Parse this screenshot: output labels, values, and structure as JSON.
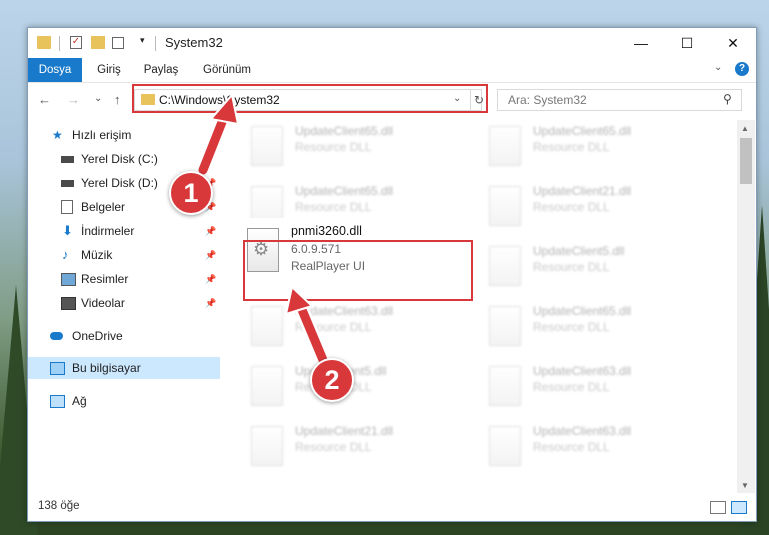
{
  "window": {
    "title": "System32"
  },
  "ribbon": {
    "tabs": [
      "Dosya",
      "Giriş",
      "Paylaş",
      "Görünüm"
    ]
  },
  "address": {
    "path": "C:\\Windows\\System32",
    "search_placeholder": "Ara: System32"
  },
  "sidebar": {
    "quick_access": "Hızlı erişim",
    "items": [
      "Yerel Disk (C:)",
      "Yerel Disk (D:)",
      "Belgeler",
      "İndirmeler",
      "Müzik",
      "Resimler",
      "Videolar"
    ],
    "onedrive": "OneDrive",
    "this_pc": "Bu bilgisayar",
    "network": "Ağ"
  },
  "files": {
    "focused": {
      "name": "pnmi3260.dll",
      "version": "6.0.9.571",
      "description": "RealPlayer UI"
    },
    "blurred": [
      {
        "name": "UpdateClient65.dll",
        "type": "Resource DLL"
      },
      {
        "name": "UpdateClient65.dll",
        "type": "Resource DLL"
      },
      {
        "name": "UpdateClient65.dll",
        "type": "Resource DLL"
      },
      {
        "name": "UpdateClient21.dll",
        "type": "Resource DLL"
      },
      {
        "name": "UpdateClient5.dll",
        "type": "Resource DLL"
      },
      {
        "name": "UpdateClient63.dll",
        "type": "Resource DLL"
      },
      {
        "name": "UpdateClient65.dll",
        "type": "Resource DLL"
      },
      {
        "name": "UpdateClient5.dll",
        "type": "Resource DLL"
      },
      {
        "name": "UpdateClient63.dll",
        "type": "Resource DLL"
      },
      {
        "name": "UpdateClient21.dll",
        "type": "Resource DLL"
      },
      {
        "name": "UpdateClient63.dll",
        "type": "Resource DLL"
      }
    ]
  },
  "status": {
    "count": "138 öğe"
  },
  "badges": [
    "1",
    "2"
  ],
  "colors": {
    "accent": "#1979ca",
    "highlight": "#d9383b",
    "selected_row": "#cce8ff",
    "folder": "#e8c25a"
  },
  "icons": {
    "back": "←",
    "forward": "→",
    "recent": "⌄",
    "up": "↑",
    "minimize": "—",
    "maximize": "☐",
    "close": "✕",
    "refresh": "↻",
    "search": "⚲",
    "pin": "📌",
    "gear": "⚙",
    "dropdown": "▾",
    "expand": "⌄",
    "help": "?",
    "sb_up": "▲",
    "sb_down": "▼"
  }
}
